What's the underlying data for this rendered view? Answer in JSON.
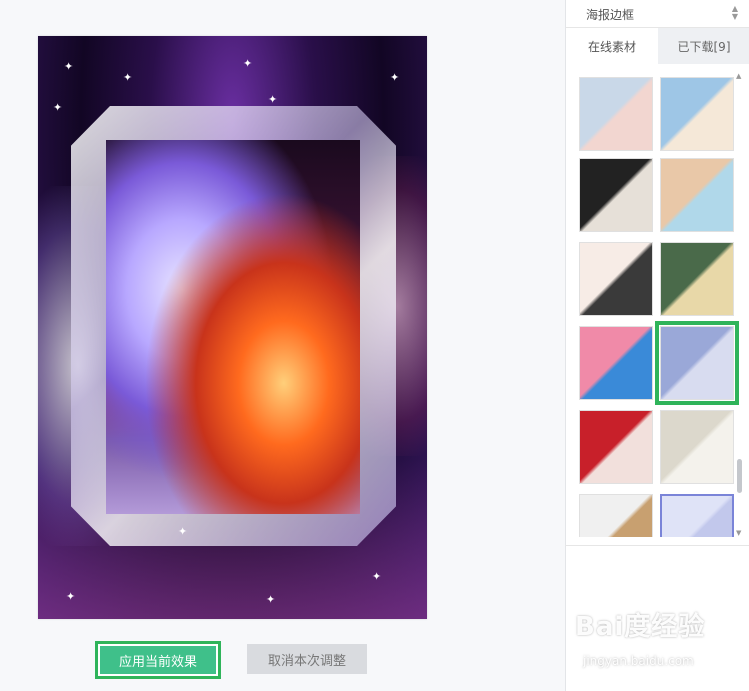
{
  "panel": {
    "dropdown_label": "海报边框",
    "tabs": [
      {
        "label": "在线素材",
        "active": true
      },
      {
        "label": "已下载[9]",
        "active": false
      }
    ]
  },
  "thumbnails": [
    {
      "name": "thumb-1",
      "colors": [
        "#c9d8e8",
        "#f2d6d0"
      ]
    },
    {
      "name": "thumb-2",
      "colors": [
        "#9ec6e6",
        "#f5e8d8"
      ]
    },
    {
      "name": "thumb-3",
      "colors": [
        "#222222",
        "#e6e0d8"
      ]
    },
    {
      "name": "thumb-4",
      "colors": [
        "#e9c8a8",
        "#b0d8ea"
      ]
    },
    {
      "name": "thumb-5",
      "colors": [
        "#f7ece6",
        "#3a3a3a"
      ]
    },
    {
      "name": "thumb-6",
      "colors": [
        "#4a6a4a",
        "#e8d8a8"
      ]
    },
    {
      "name": "thumb-7",
      "colors": [
        "#f08aa8",
        "#3a8ad8"
      ]
    },
    {
      "name": "thumb-8",
      "colors": [
        "#9aa8d8",
        "#d8dcf0"
      ],
      "selected": true
    },
    {
      "name": "thumb-9",
      "colors": [
        "#c8202a",
        "#f2e0dc"
      ]
    },
    {
      "name": "thumb-10",
      "colors": [
        "#dcd8cc",
        "#f4f2ec"
      ]
    },
    {
      "name": "thumb-11",
      "colors": [
        "#f0f0f0",
        "#c8a070"
      ]
    },
    {
      "name": "thumb-12",
      "colors": [
        "#dfe3f7",
        "#c2c8ec"
      ],
      "current": true
    }
  ],
  "buttons": {
    "apply": "应用当前效果",
    "cancel": "取消本次调整"
  },
  "watermark": {
    "main": "Bai度经验",
    "sub": "jingyan.baidu.com"
  }
}
